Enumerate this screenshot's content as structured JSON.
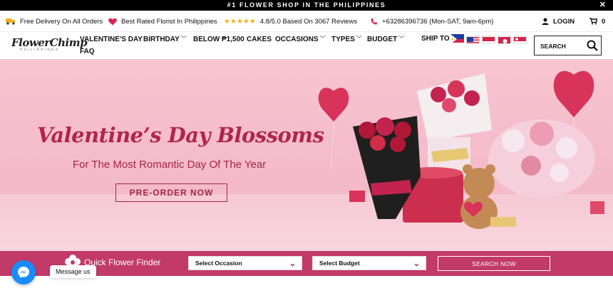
{
  "topbar": {
    "text": "#1 FLOWER SHOP IN THE PHILIPPINES",
    "close": "✕"
  },
  "infobar": {
    "delivery": "Free Delivery On All Orders",
    "florist": "Best Rated Florist In Philippines",
    "stars": "★★★★★",
    "rating": "4.8/5.0 Based On 3067 Reviews",
    "phone": "+63286396736 (Mon-SAT, 9am-6pm)",
    "login": "LOGIN",
    "cart_count": "0"
  },
  "logo": {
    "name": "FlowerChimp",
    "sub": "PHILIPPINES"
  },
  "menu": {
    "valentines": "VALENTINE'S DAY",
    "birthday": "BIRTHDAY",
    "below": "BELOW ₱1,500",
    "cakes": "CAKES",
    "occasions": "OCCASIONS",
    "types": "TYPES",
    "budget": "BUDGET",
    "faq": "FAQ"
  },
  "ship_to": "SHIP TO",
  "search": {
    "label": "SEARCH"
  },
  "hero": {
    "title": "Valentine’s Day Blossoms",
    "subtitle": "For The Most Romantic Day Of The Year",
    "cta": "PRE-ORDER NOW"
  },
  "finder": {
    "title": "Quick Flower Finder",
    "occasion": "Select Occasion",
    "budget": "Select Budget",
    "search": "SEARCH NOW"
  },
  "messenger": {
    "label": "Message us"
  },
  "colors": {
    "accent": "#c23a68",
    "hero_text": "#b0264a",
    "messenger": "#1a8cff"
  }
}
